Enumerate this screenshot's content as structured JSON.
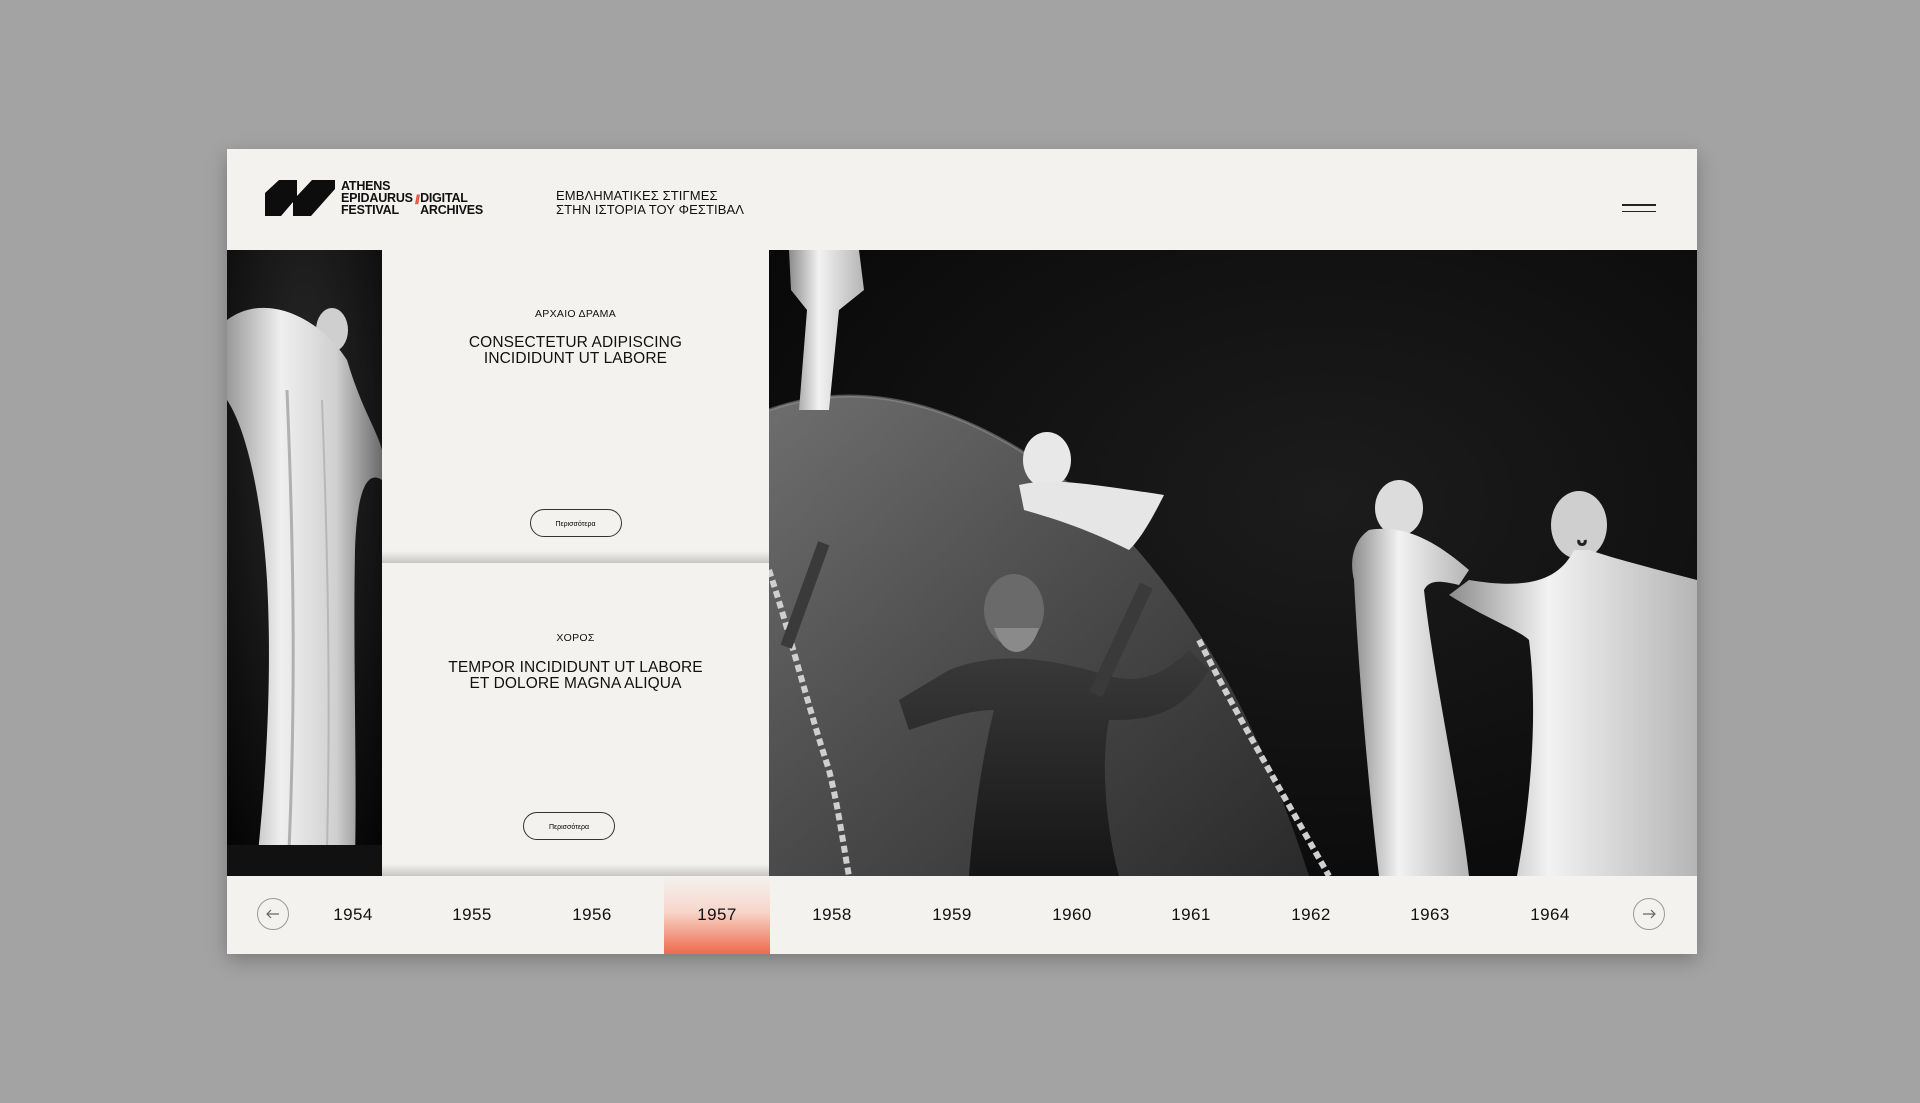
{
  "header": {
    "logo": {
      "left_lines": [
        "ATHENS",
        "EPIDAURUS",
        "FESTIVAL"
      ],
      "separator": "//",
      "right_lines": [
        "DIGITAL",
        "ARCHIVES"
      ]
    },
    "tagline": [
      "ΕΜΒΛΗΜΑΤΙΚΕΣ ΣΤΙΓΜΕΣ",
      "ΣΤΗΝ ΙΣΤΟΡΙΑ ΤΟΥ ΦΕΣΤΙΒΑΛ"
    ],
    "menu_icon": "hamburger-icon"
  },
  "cards": [
    {
      "category": "ΑΡΧΑΙΟ ΔΡΑΜΑ",
      "title_lines": [
        "CONSECTETUR ADIPISCING",
        "INCIDIDUNT UT LABORE"
      ],
      "button": "Περισσότερα"
    },
    {
      "category": "ΧΟΡΟΣ",
      "title_lines": [
        "TEMPOR INCIDIDUNT UT LABORE",
        "ET DOLORE MAGNA ALIQUA"
      ],
      "button": "Περισσότερα"
    }
  ],
  "timeline": {
    "prev_icon": "arrow-left-icon",
    "next_icon": "arrow-right-icon",
    "years": [
      "1954",
      "1955",
      "1956",
      "1957",
      "1958",
      "1959",
      "1960",
      "1961",
      "1962",
      "1963",
      "1964"
    ],
    "active_year": "1957"
  },
  "colors": {
    "accent": "#ef6a4c",
    "panel": "#f4f2ef",
    "backdrop": "#a3a3a3"
  }
}
